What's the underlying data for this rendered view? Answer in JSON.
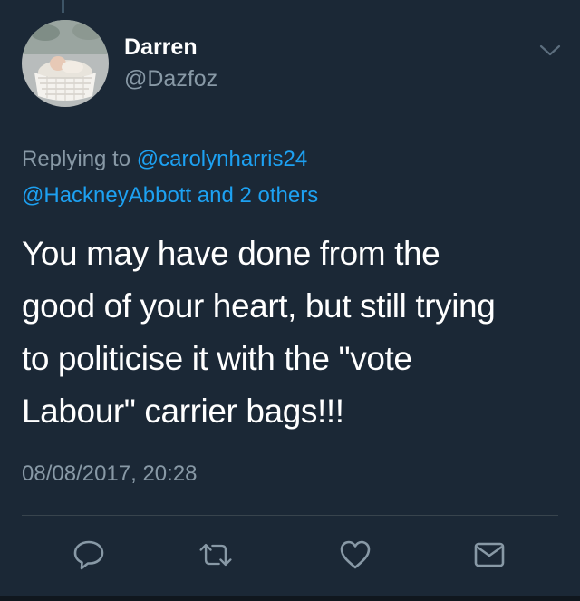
{
  "theme": {
    "background": "#1b2836",
    "text_primary": "#ffffff",
    "text_muted": "#8899a6",
    "link": "#1da1f2",
    "divider": "#38444d"
  },
  "tweet": {
    "author": {
      "display_name": "Darren",
      "handle": "@Dazfoz",
      "avatar_icon": "avatar-baby-in-basket"
    },
    "reply_context": {
      "prefix": "Replying to",
      "first_mention": "@carolynharris24",
      "second_mention": "@HackneyAbbott",
      "others": "and 2 others"
    },
    "lines": [
      "You may have done from the",
      "good of your heart, but still trying",
      "to politicise it with the \"vote",
      "Labour\" carrier bags!!!"
    ],
    "timestamp": "08/08/2017, 20:28"
  },
  "actions": [
    {
      "icon": "reply-icon"
    },
    {
      "icon": "retweet-icon"
    },
    {
      "icon": "like-icon"
    },
    {
      "icon": "direct-message-icon"
    }
  ],
  "menu": {
    "icon": "chevron-down-icon"
  }
}
